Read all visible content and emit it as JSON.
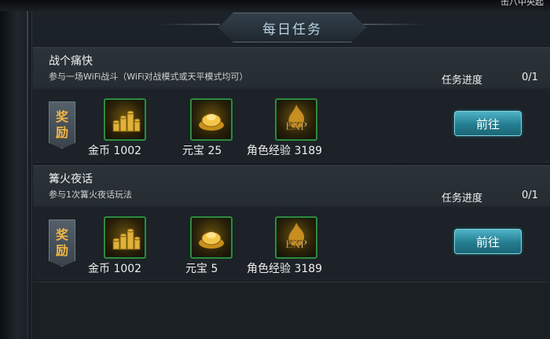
{
  "top_right_text": "击八中央起",
  "title": "每日任务",
  "reward_badge": [
    "奖",
    "励"
  ],
  "go_label": "前往",
  "progress_label": "任务进度",
  "colors": {
    "button": "#247d90",
    "badge_text": "#f3b743",
    "title_text": "#b9d2e2",
    "icon_border": "#2f8a3c"
  },
  "tasks": [
    {
      "title": "战个痛快",
      "description": "参与一场WiFi战斗（WiFi对战模式或天平模式均可）",
      "progress": "0/1",
      "rewards": [
        {
          "icon": "gold-coins-icon",
          "label": "金币 1002"
        },
        {
          "icon": "gold-ingot-icon",
          "label": "元宝 25"
        },
        {
          "icon": "exp-icon",
          "label": "角色经验 3189"
        }
      ]
    },
    {
      "title": "篝火夜话",
      "description": "参与1次篝火夜话玩法",
      "progress": "0/1",
      "rewards": [
        {
          "icon": "gold-coins-icon",
          "label": "金币 1002"
        },
        {
          "icon": "gold-ingot-icon",
          "label": "元宝 5"
        },
        {
          "icon": "exp-icon",
          "label": "角色经验 3189"
        }
      ]
    }
  ]
}
